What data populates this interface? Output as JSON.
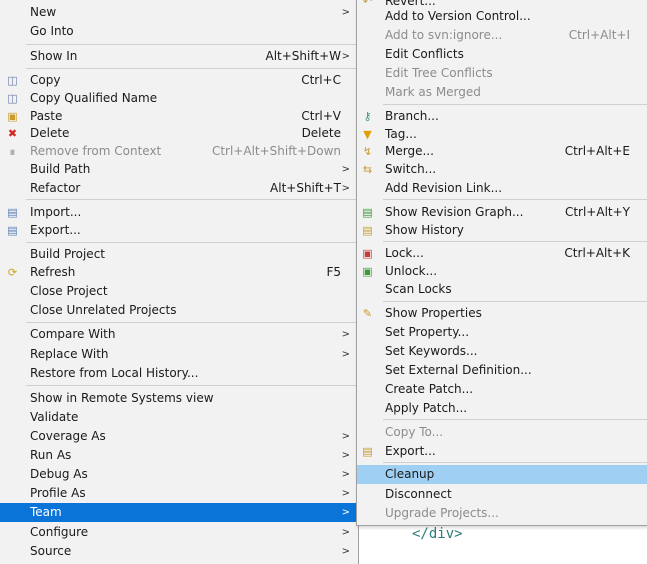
{
  "main_menu": {
    "new": "New",
    "go_into": "Go Into",
    "show_in": "Show In",
    "show_in_shortcut": "Alt+Shift+W",
    "copy": "Copy",
    "copy_shortcut": "Ctrl+C",
    "copy_qualified": "Copy Qualified Name",
    "paste": "Paste",
    "paste_shortcut": "Ctrl+V",
    "delete": "Delete",
    "delete_shortcut": "Delete",
    "remove_context": "Remove from Context",
    "remove_context_shortcut": "Ctrl+Alt+Shift+Down",
    "build_path": "Build Path",
    "refactor": "Refactor",
    "refactor_shortcut": "Alt+Shift+T",
    "import": "Import...",
    "export": "Export...",
    "build_project": "Build Project",
    "refresh": "Refresh",
    "refresh_shortcut": "F5",
    "close_project": "Close Project",
    "close_unrelated": "Close Unrelated Projects",
    "compare_with": "Compare With",
    "replace_with": "Replace With",
    "restore_history": "Restore from Local History...",
    "show_remote": "Show in Remote Systems view",
    "validate": "Validate",
    "coverage_as": "Coverage As",
    "run_as": "Run As",
    "debug_as": "Debug As",
    "profile_as": "Profile As",
    "team": "Team",
    "configure": "Configure",
    "source": "Source",
    "arrow": ">"
  },
  "team_menu": {
    "revert": "Revert...",
    "add_version_control": "Add to Version Control...",
    "add_svn_ignore": "Add to svn:ignore...",
    "add_svn_ignore_shortcut": "Ctrl+Alt+I",
    "edit_conflicts": "Edit Conflicts",
    "edit_tree_conflicts": "Edit Tree Conflicts",
    "mark_merged": "Mark as Merged",
    "branch": "Branch...",
    "tag": "Tag...",
    "merge": "Merge...",
    "merge_shortcut": "Ctrl+Alt+E",
    "switch": "Switch...",
    "add_revision_link": "Add Revision Link...",
    "show_revision_graph": "Show Revision Graph...",
    "show_revision_graph_shortcut": "Ctrl+Alt+Y",
    "show_history": "Show History",
    "lock": "Lock...",
    "lock_shortcut": "Ctrl+Alt+K",
    "unlock": "Unlock...",
    "scan_locks": "Scan Locks",
    "show_properties": "Show Properties",
    "set_property": "Set Property...",
    "set_keywords": "Set Keywords...",
    "set_external": "Set External Definition...",
    "create_patch": "Create Patch...",
    "apply_patch": "Apply Patch...",
    "copy_to": "Copy To...",
    "export": "Export...",
    "cleanup": "Cleanup",
    "disconnect": "Disconnect",
    "upgrade_projects": "Upgrade Projects..."
  },
  "editor": {
    "line1": "</div>"
  },
  "colors": {
    "menu_bg": "#f2f2f2",
    "selected_main": "#0b74d9",
    "selected_sub": "#9fd0f3",
    "disabled_text": "#8c8c8c"
  }
}
